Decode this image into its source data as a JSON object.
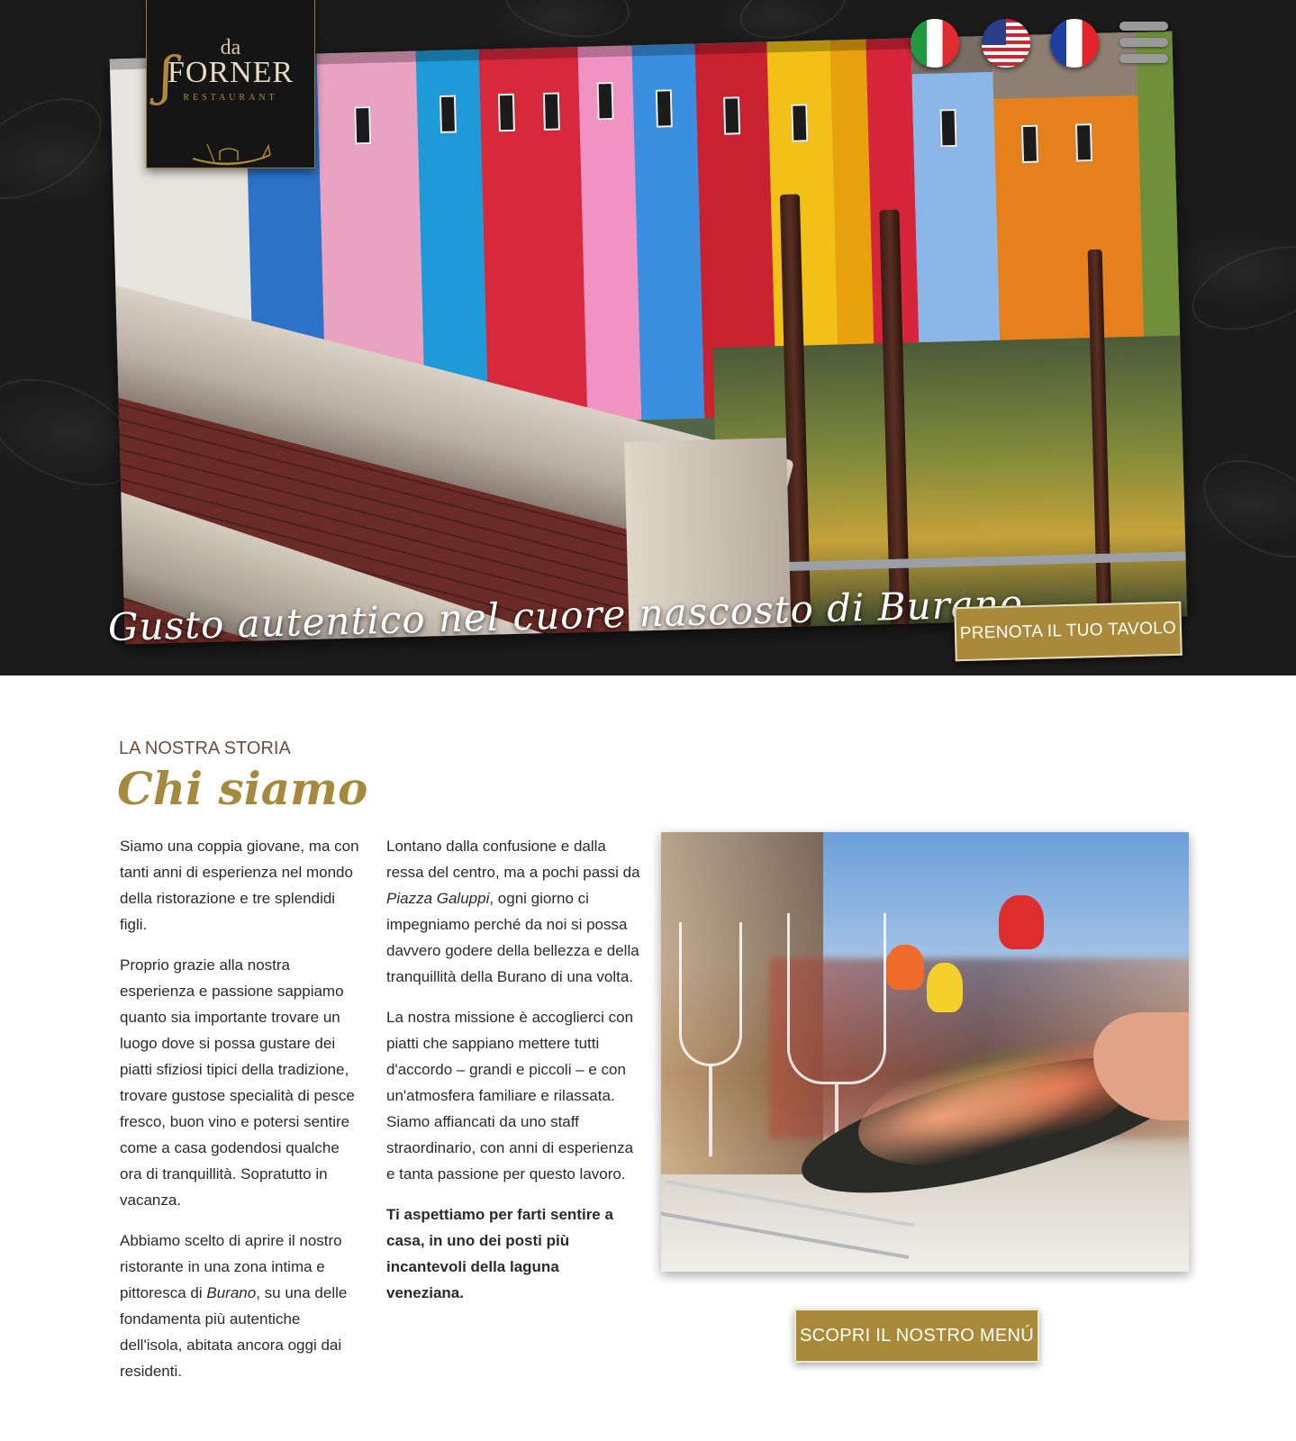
{
  "brand": {
    "logo_prefix": "da",
    "logo_name": "FORNER",
    "logo_tagline": "RESTAURANT",
    "gold_color": "#a88a3a",
    "dark_color": "#1c1c1c"
  },
  "header": {
    "languages": [
      {
        "code": "it",
        "icon": "flag-italy-icon"
      },
      {
        "code": "en",
        "icon": "flag-usa-icon"
      },
      {
        "code": "fr",
        "icon": "flag-france-icon"
      }
    ],
    "menu_icon": "hamburger-menu-icon"
  },
  "hero": {
    "tagline": "Gusto autentico nel cuore nascosto di Burano",
    "cta_label": "PRENOTA IL TUO TAVOLO"
  },
  "about": {
    "eyebrow": "LA NOSTRA STORIA",
    "title": "Chi siamo",
    "left_column": {
      "p1": "Siamo una coppia giovane, ma con tanti anni di esperienza nel mondo della ristorazione e tre splendidi figli.",
      "p2": "Proprio grazie alla nostra esperienza e passione sappiamo quanto sia importante trovare un luogo dove si possa gustare dei piatti sfiziosi tipici della tradizione, trovare gustose specialità di pesce fresco, buon vino e potersi sentire come a casa godendosi qualche ora di tranquillità. Sopratutto in vacanza.",
      "p3_before": "Abbiamo scelto di aprire il nostro ristorante in una zona intima e pittoresca di ",
      "p3_em": "Burano",
      "p3_after": ", su una delle fondamenta più autentiche dell'isola, abitata ancora oggi dai residenti."
    },
    "middle_column": {
      "p1_before": "Lontano dalla confusione e dalla ressa del centro, ma a pochi passi da ",
      "p1_em": "Piazza Galuppi",
      "p1_after": ", ogni giorno ci impegniamo perché da noi si possa davvero godere della bellezza e della tranquillità della Burano di una volta.",
      "p2": "La nostra missione è accoglierci con piatti che sappiano mettere tutti d'accordo – grandi e piccoli – e con un'atmosfera familiare e rilassata. Siamo affiancati da uno staff straordinario, con anni di esperienza e tanta passione per questo lavoro.",
      "p3": "Ti aspettiamo per farti sentire a casa, in uno dei posti più incantevoli della laguna veneziana."
    },
    "cta_label": "SCOPRI IL NOSTRO MENÚ"
  }
}
